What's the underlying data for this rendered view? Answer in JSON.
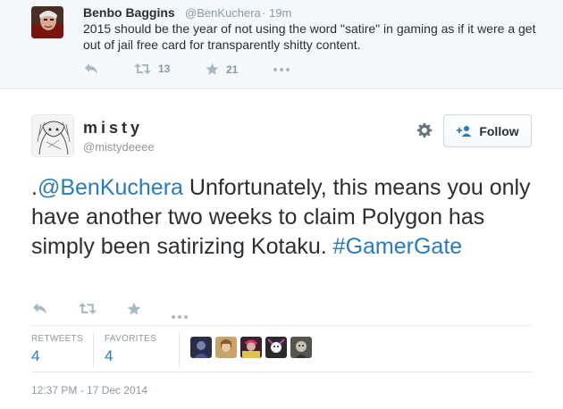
{
  "parent_tweet": {
    "name": "Benbo Baggins",
    "handle": "@BenKuchera",
    "separator": "·",
    "time": "19m",
    "text": "2015 should be the year of not using the word \"satire\" in gaming as if it were a get out of jail free card for transparently shitty content.",
    "retweets": "13",
    "favorites": "21"
  },
  "main_tweet": {
    "name": "misty",
    "handle": "@mistydeeee",
    "follow_label": "Follow",
    "text_prefix": ".",
    "mention": "@BenKuchera",
    "text_body": " Unfortunately, this means you only have another two weeks to claim Polygon has simply been satirizing Kotaku. ",
    "hashtag": "#GamerGate",
    "stats": {
      "retweets_label": "RETWEETS",
      "retweets_value": "4",
      "favorites_label": "FAVORITES",
      "favorites_value": "4"
    },
    "timestamp": "12:37 PM - 17 Dec 2014"
  },
  "colors": {
    "link": "#2b7bb9",
    "muted": "#8899a6",
    "icon": "#aab8c2",
    "text": "#292f33",
    "parent_bg": "#f5f8fa"
  },
  "icons": {
    "reply": "reply-icon",
    "retweet": "retweet-icon",
    "favorite": "star-icon",
    "more": "more-icon",
    "settings": "gear-icon",
    "follow": "follow-person-icon"
  }
}
